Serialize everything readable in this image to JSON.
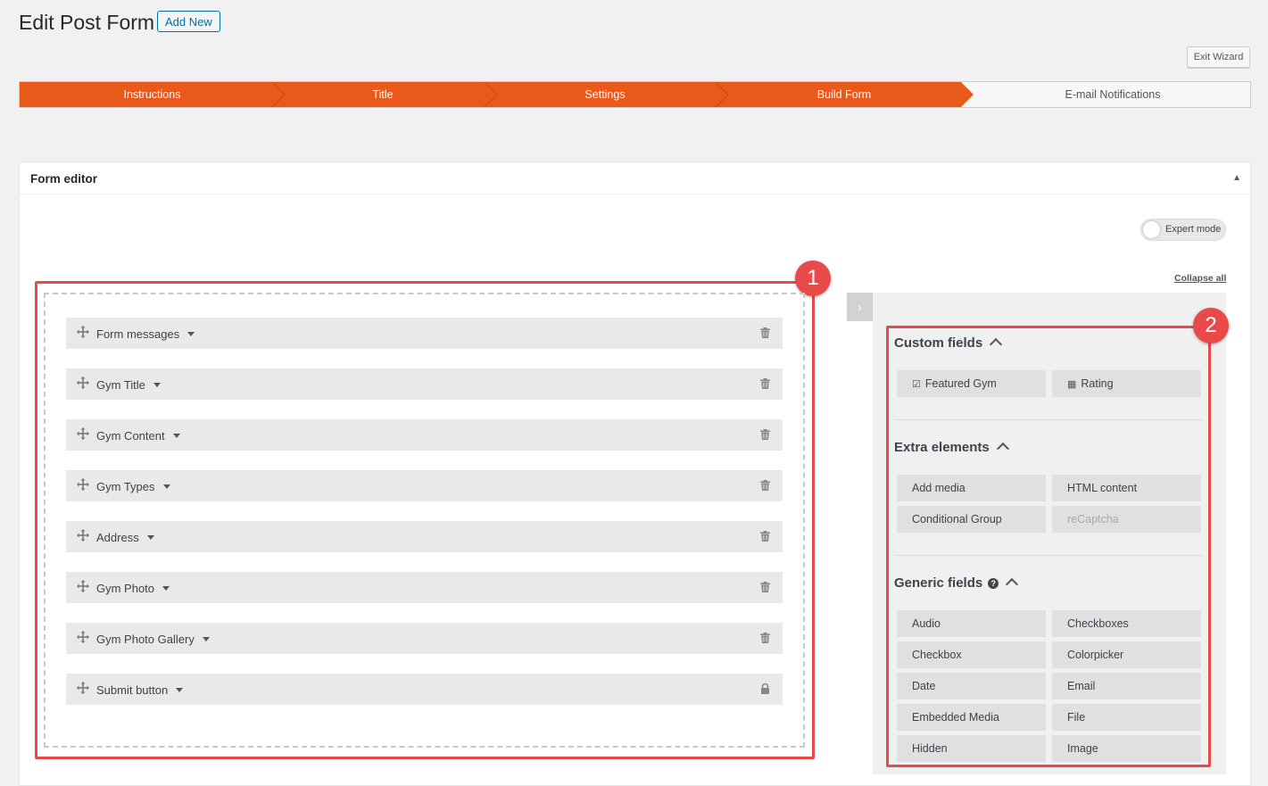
{
  "header": {
    "title": "Edit Post Form",
    "add_new": "Add New",
    "exit_wizard": "Exit Wizard"
  },
  "colors": {
    "accent": "#e8591a",
    "callout": "#e94949"
  },
  "steps": [
    {
      "label": "Instructions",
      "state": "done"
    },
    {
      "label": "Title",
      "state": "done"
    },
    {
      "label": "Settings",
      "state": "done"
    },
    {
      "label": "Build Form",
      "state": "current"
    },
    {
      "label": "E-mail Notifications",
      "state": "todo"
    }
  ],
  "editor": {
    "title": "Form editor",
    "expert_mode": "Expert mode",
    "collapse_all": "Collapse all",
    "callout_1": "1",
    "callout_2": "2",
    "fields": [
      {
        "label": "Form messages",
        "icon": "trash-icon"
      },
      {
        "label": "Gym Title",
        "icon": "trash-icon"
      },
      {
        "label": "Gym Content",
        "icon": "trash-icon"
      },
      {
        "label": "Gym Types",
        "icon": "trash-icon"
      },
      {
        "label": "Address",
        "icon": "trash-icon"
      },
      {
        "label": "Gym Photo",
        "icon": "trash-icon"
      },
      {
        "label": "Gym Photo Gallery",
        "icon": "trash-icon"
      },
      {
        "label": "Submit button",
        "icon": "lock-icon"
      }
    ]
  },
  "sidebar": {
    "custom_fields": {
      "title": "Custom fields",
      "items": [
        "Featured Gym",
        "Rating"
      ]
    },
    "extra_elements": {
      "title": "Extra elements",
      "items": [
        "Add media",
        "HTML content",
        "Conditional Group",
        "reCaptcha"
      ]
    },
    "generic_fields": {
      "title": "Generic fields",
      "items": [
        "Audio",
        "Checkboxes",
        "Checkbox",
        "Colorpicker",
        "Date",
        "Email",
        "Embedded Media",
        "File",
        "Hidden",
        "Image"
      ]
    }
  }
}
